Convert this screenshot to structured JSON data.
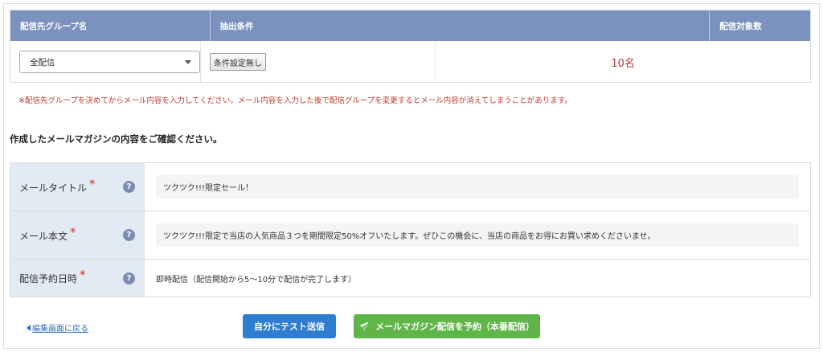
{
  "group_table": {
    "headers": [
      "配信先グループ名",
      "抽出条件",
      "配信対象数"
    ],
    "group_select": "全配信",
    "condition_button": "条件設定無し",
    "target_count": "10名"
  },
  "warning": "※配信先グループを決めてからメール内容を入力してください。メール内容を入力した後で配信グループを変更するとメール内容が消えてしまうことがあります。",
  "confirm_title": "作成したメールマガジンの内容をご確認ください。",
  "form": {
    "required_mark": "*",
    "help_mark": "?",
    "rows": [
      {
        "label": "メールタイトル",
        "value": "ツクツク!!!限定セール！"
      },
      {
        "label": "メール本文",
        "value": "ツクツク!!!限定で当店の人気商品３つを期間限定50%オフいたします。ぜひこの機会に、当店の商品をお得にお買い求めくださいませ。"
      },
      {
        "label": "配信予約日時",
        "value": "即時配信（配信開始から5〜10分で配信が完了します）"
      }
    ]
  },
  "actions": {
    "back_link": "編集画面に戻る",
    "test_send": "自分にテスト送信",
    "reserve_send": "メールマガジン配信を予約（本番配信）"
  },
  "colors": {
    "header_bg": "#7b92bf",
    "label_bg": "#e2eaf4",
    "test_button": "#2f7dd1",
    "reserve_button": "#5fb548",
    "warning_text": "#c0392b"
  }
}
